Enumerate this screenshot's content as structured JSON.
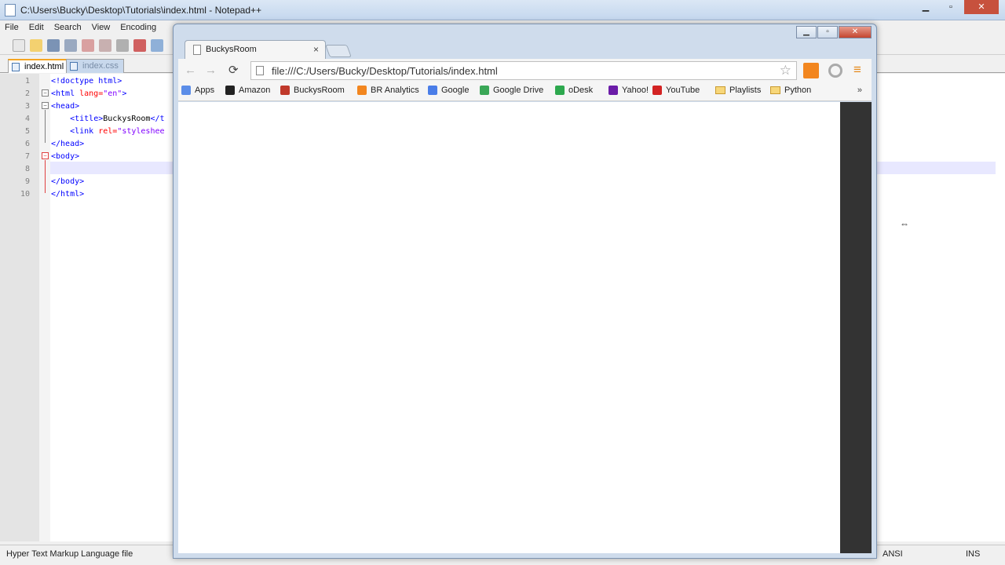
{
  "notepadpp": {
    "title": "C:\\Users\\Bucky\\Desktop\\Tutorials\\index.html - Notepad++",
    "window_buttons": {
      "minimize": "▁",
      "maximize": "▫",
      "close": "✕"
    },
    "menu": [
      "File",
      "Edit",
      "Search",
      "View",
      "Encoding"
    ],
    "tabs": [
      {
        "label": "index.html",
        "active": true
      },
      {
        "label": "index.css",
        "active": false
      }
    ],
    "lines": [
      {
        "num": "1",
        "indent": "",
        "tag_open": "<!doctype html>",
        "attr": "",
        "val": "",
        "txt": "",
        "tag_close": ""
      },
      {
        "num": "2",
        "indent": "",
        "tag_open": "<html ",
        "attr": "lang=",
        "val": "\"en\"",
        "txt": "",
        "tag_close": ">"
      },
      {
        "num": "3",
        "indent": "",
        "tag_open": "<head>",
        "attr": "",
        "val": "",
        "txt": "",
        "tag_close": ""
      },
      {
        "num": "4",
        "indent": "    ",
        "tag_open": "<title>",
        "attr": "",
        "val": "",
        "txt": "BuckysRoom",
        "tag_close": "</t"
      },
      {
        "num": "5",
        "indent": "    ",
        "tag_open": "<link ",
        "attr": "rel=",
        "val": "\"styleshee",
        "txt": "",
        "tag_close": ""
      },
      {
        "num": "6",
        "indent": "",
        "tag_open": "</head>",
        "attr": "",
        "val": "",
        "txt": "",
        "tag_close": ""
      },
      {
        "num": "7",
        "indent": "",
        "tag_open": "<body>",
        "attr": "",
        "val": "",
        "txt": "",
        "tag_close": ""
      },
      {
        "num": "8",
        "indent": "",
        "tag_open": "",
        "attr": "",
        "val": "",
        "txt": "",
        "tag_close": ""
      },
      {
        "num": "9",
        "indent": "",
        "tag_open": "</body>",
        "attr": "",
        "val": "",
        "txt": "",
        "tag_close": ""
      },
      {
        "num": "10",
        "indent": "",
        "tag_open": "</html>",
        "attr": "",
        "val": "",
        "txt": "",
        "tag_close": ""
      }
    ],
    "status": {
      "file_type": "Hyper Text Markup Language file",
      "encoding": "ANSI",
      "mode": "INS"
    }
  },
  "chrome": {
    "window_buttons": {
      "minimize": "▁",
      "maximize": "▫",
      "close": "✕"
    },
    "tab": {
      "title": "BuckysRoom",
      "close": "×"
    },
    "nav": {
      "back": "←",
      "forward": "→",
      "reload": "C"
    },
    "url": "file:///C:/Users/Bucky/Desktop/Tutorials/index.html",
    "star": "☆",
    "menu_icon": "≡",
    "bookmarks": [
      {
        "label": "Apps",
        "icon": "apps-icon",
        "color": "#5b8de8"
      },
      {
        "label": "Amazon",
        "icon": "amazon-icon",
        "color": "#222222"
      },
      {
        "label": "BuckysRoom",
        "icon": "buckysroom-icon",
        "color": "#c0392b"
      },
      {
        "label": "BR Analytics",
        "icon": "analytics-icon",
        "color": "#f2861f"
      },
      {
        "label": "Google",
        "icon": "google-icon",
        "color": "#4a7de8"
      },
      {
        "label": "Google Drive",
        "icon": "drive-icon",
        "color": "#3aa757"
      },
      {
        "label": "oDesk",
        "icon": "odesk-icon",
        "color": "#2da84e"
      },
      {
        "label": "Yahoo!",
        "icon": "yahoo-icon",
        "color": "#6b1ca8"
      },
      {
        "label": "YouTube",
        "icon": "youtube-icon",
        "color": "#d32323"
      },
      {
        "label": "Playlists",
        "icon": "folder-icon",
        "color": "folder"
      },
      {
        "label": "Python",
        "icon": "folder-icon",
        "color": "folder"
      }
    ],
    "bookmarks_more": "»"
  }
}
